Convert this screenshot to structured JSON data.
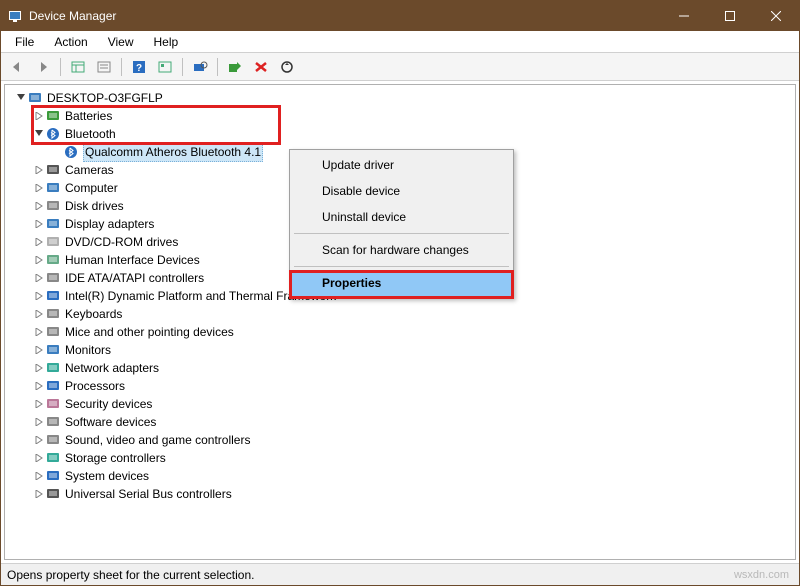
{
  "window": {
    "title": "Device Manager"
  },
  "menubar": {
    "items": [
      "File",
      "Action",
      "View",
      "Help"
    ]
  },
  "tree": {
    "root": "DESKTOP-O3FGFLP",
    "nodes": [
      {
        "label": "Batteries",
        "icon": "battery",
        "indent": 1,
        "expanded": false
      },
      {
        "label": "Bluetooth",
        "icon": "bluetooth",
        "indent": 1,
        "expanded": true
      },
      {
        "label": "Qualcomm Atheros Bluetooth 4.1",
        "icon": "bluetooth",
        "indent": 2,
        "selected": true
      },
      {
        "label": "Cameras",
        "icon": "camera",
        "indent": 1,
        "expanded": false
      },
      {
        "label": "Computer",
        "icon": "computer",
        "indent": 1,
        "expanded": false
      },
      {
        "label": "Disk drives",
        "icon": "disk",
        "indent": 1,
        "expanded": false
      },
      {
        "label": "Display adapters",
        "icon": "display",
        "indent": 1,
        "expanded": false
      },
      {
        "label": "DVD/CD-ROM drives",
        "icon": "cd",
        "indent": 1,
        "expanded": false
      },
      {
        "label": "Human Interface Devices",
        "icon": "hid",
        "indent": 1,
        "expanded": false
      },
      {
        "label": "IDE ATA/ATAPI controllers",
        "icon": "ide",
        "indent": 1,
        "expanded": false
      },
      {
        "label": "Intel(R) Dynamic Platform and Thermal Framework",
        "icon": "chip",
        "indent": 1,
        "expanded": false
      },
      {
        "label": "Keyboards",
        "icon": "keyboard",
        "indent": 1,
        "expanded": false
      },
      {
        "label": "Mice and other pointing devices",
        "icon": "mouse",
        "indent": 1,
        "expanded": false
      },
      {
        "label": "Monitors",
        "icon": "monitor",
        "indent": 1,
        "expanded": false
      },
      {
        "label": "Network adapters",
        "icon": "network",
        "indent": 1,
        "expanded": false
      },
      {
        "label": "Processors",
        "icon": "cpu",
        "indent": 1,
        "expanded": false
      },
      {
        "label": "Security devices",
        "icon": "security",
        "indent": 1,
        "expanded": false
      },
      {
        "label": "Software devices",
        "icon": "software",
        "indent": 1,
        "expanded": false
      },
      {
        "label": "Sound, video and game controllers",
        "icon": "sound",
        "indent": 1,
        "expanded": false
      },
      {
        "label": "Storage controllers",
        "icon": "storage",
        "indent": 1,
        "expanded": false
      },
      {
        "label": "System devices",
        "icon": "system",
        "indent": 1,
        "expanded": false
      },
      {
        "label": "Universal Serial Bus controllers",
        "icon": "usb",
        "indent": 1,
        "expanded": false
      }
    ]
  },
  "context_menu": {
    "items": [
      {
        "label": "Update driver"
      },
      {
        "label": "Disable device"
      },
      {
        "label": "Uninstall device"
      },
      {
        "sep": true
      },
      {
        "label": "Scan for hardware changes"
      },
      {
        "sep": true
      },
      {
        "label": "Properties",
        "highlight": true
      }
    ]
  },
  "statusbar": {
    "text": "Opens property sheet for the current selection.",
    "watermark": "wsxdn.com"
  },
  "colors": {
    "title_bg": "#6b4a2b",
    "highlight_red": "#e02020",
    "ctx_highlight": "#90c8f6",
    "selected_bg": "#cde6f7"
  }
}
